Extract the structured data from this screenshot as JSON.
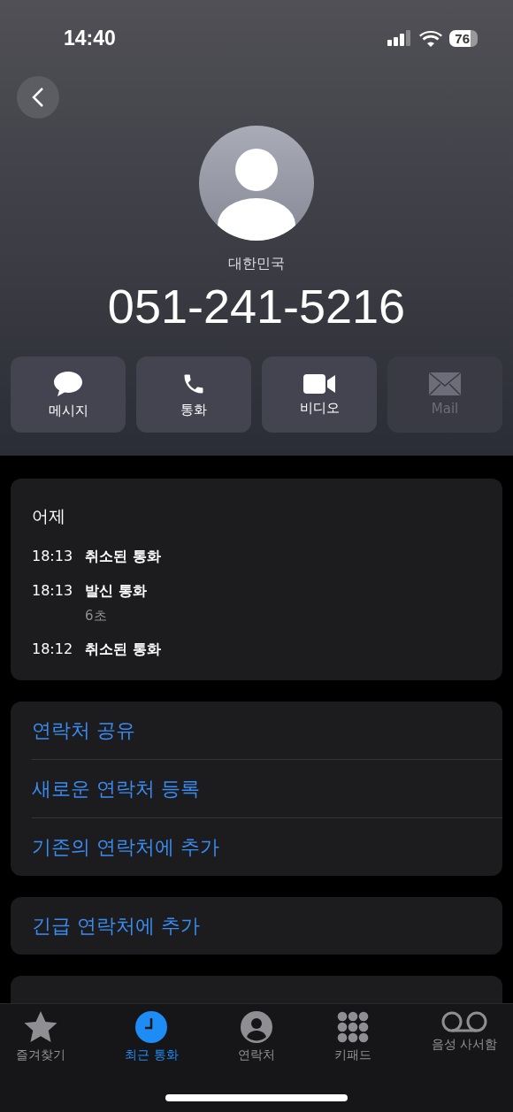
{
  "status_bar": {
    "time": "14:40",
    "battery": "76"
  },
  "contact": {
    "country": "대한민국",
    "number": "051-241-5216"
  },
  "actions": [
    {
      "kind": "message",
      "label": "메시지",
      "disabled": false
    },
    {
      "kind": "call",
      "label": "통화",
      "disabled": false
    },
    {
      "kind": "video",
      "label": "비디오",
      "disabled": false
    },
    {
      "kind": "mail",
      "label": "Mail",
      "disabled": true
    }
  ],
  "history": {
    "date": "어제",
    "calls": [
      {
        "time": "18:13",
        "type": "취소된 통화"
      },
      {
        "time": "18:13",
        "type": "발신 통화",
        "duration": "6초"
      },
      {
        "time": "18:12",
        "type": "취소된 통화"
      }
    ]
  },
  "contact_actions": [
    "연락처 공유",
    "새로운 연락처 등록",
    "기존의 연락처에 추가"
  ],
  "emergency_action": "긴급 연락처에 추가",
  "tab_bar": [
    {
      "kind": "favorites",
      "label": "즐겨찾기",
      "selected": false
    },
    {
      "kind": "recents",
      "label": "최근 통화",
      "selected": true
    },
    {
      "kind": "contacts",
      "label": "연락처",
      "selected": false
    },
    {
      "kind": "keypad",
      "label": "키패드",
      "selected": false
    },
    {
      "kind": "voicemail",
      "label": "음성 사서함",
      "selected": false
    }
  ]
}
